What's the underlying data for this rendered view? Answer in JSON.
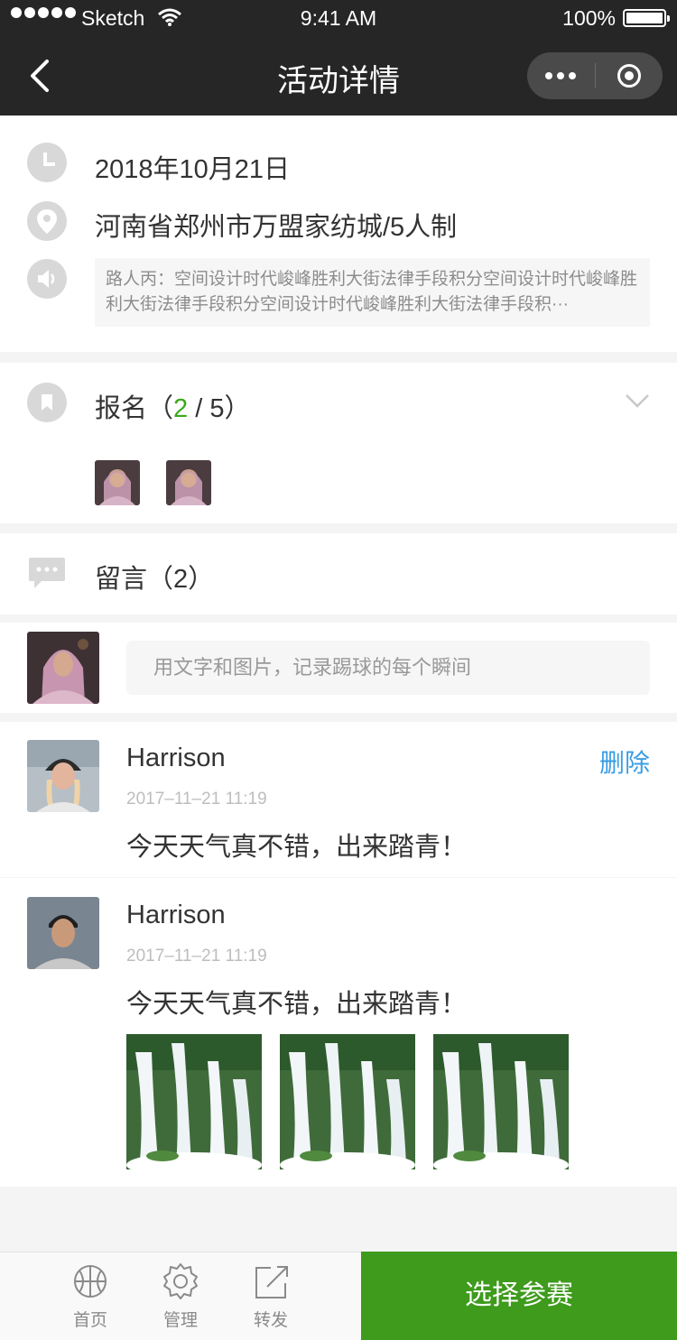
{
  "status_bar": {
    "carrier": "Sketch",
    "time": "9:41 AM",
    "battery": "100%"
  },
  "nav": {
    "title": "活动详情"
  },
  "event": {
    "date": "2018年10月21日",
    "location": "河南省郑州市万盟家纺城/5人制",
    "notice": "路人丙：空间设计时代峻峰胜利大街法律手段积分空间设计时代峻峰胜利大街法律手段积分空间设计时代峻峰胜利大街法律手段积···"
  },
  "signup": {
    "label_prefix": "报名（",
    "current": "2",
    "separator": " / ",
    "total": "5",
    "label_suffix": "）"
  },
  "messages": {
    "label": "留言（2）",
    "compose_placeholder": "用文字和图片，记录踢球的每个瞬间"
  },
  "comments": [
    {
      "name": "Harrison",
      "date": "2017–11–21  11:19",
      "text": "今天天气真不错，出来踏青！",
      "delete_label": "删除"
    },
    {
      "name": "Harrison",
      "date": "2017–11–21  11:19",
      "text": "今天天气真不错，出来踏青！"
    }
  ],
  "tabbar": {
    "tabs": [
      {
        "label": "首页",
        "icon": "basketball-icon"
      },
      {
        "label": "管理",
        "icon": "gear-icon"
      },
      {
        "label": "转发",
        "icon": "share-icon"
      }
    ],
    "cta_label": "选择参赛"
  },
  "colors": {
    "nav_bg": "#262626",
    "accent_green": "#3e9b1c",
    "link_blue": "#3a9ee4"
  }
}
